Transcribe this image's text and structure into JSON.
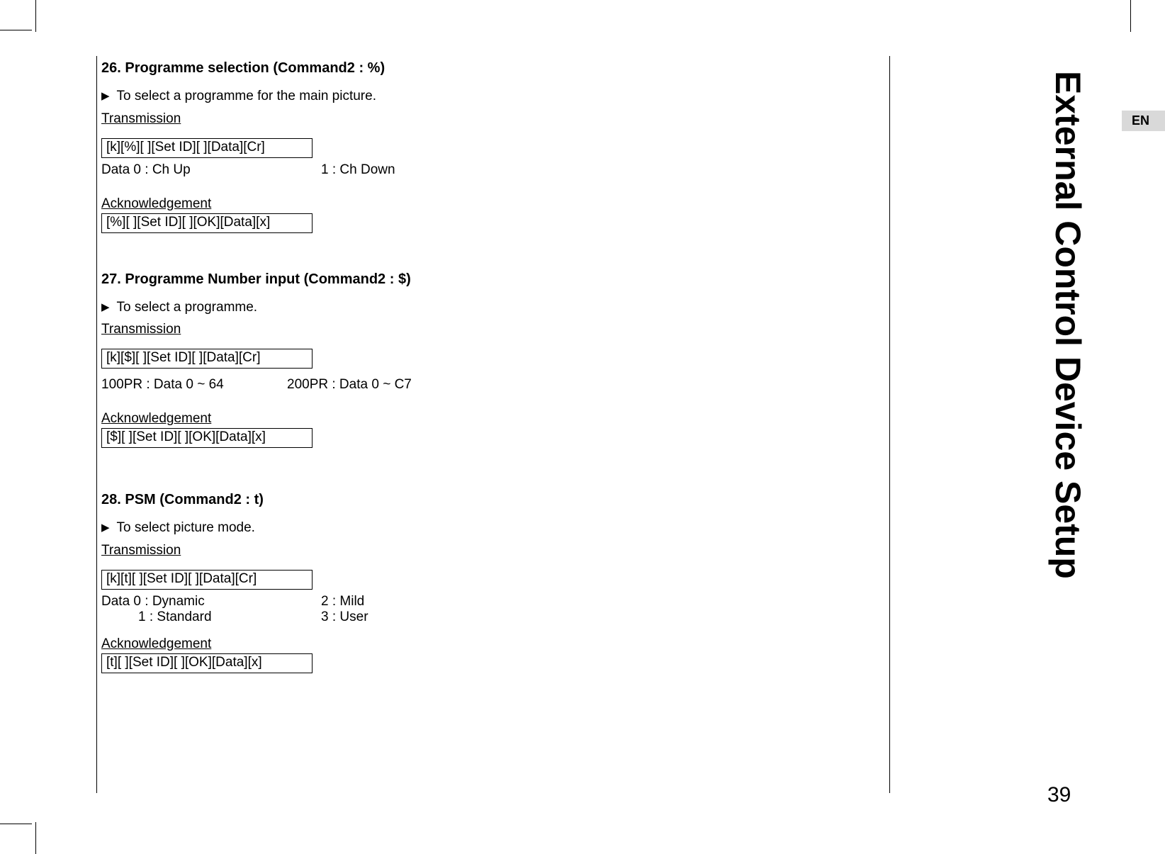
{
  "side_title": "External Control Device Setup",
  "lang_tab": "EN",
  "page_number": "39",
  "sections": [
    {
      "title": "26. Programme selection (Command2 : %)",
      "desc": "To select a programme for the main picture.",
      "trans_label": "Transmission",
      "trans_cmd": "[k][%][  ][Set ID][  ][Data][Cr]",
      "data_lines": [
        {
          "col1": "Data  0  : Ch Up",
          "col2": "1  : Ch Down"
        }
      ],
      "ack_label": "Acknowledgement",
      "ack_cmd": "[%][  ][Set ID][  ][OK][Data][x]"
    },
    {
      "title": "27. Programme Number input (Command2 : $)",
      "desc": "To select a programme.",
      "trans_label": "Transmission",
      "trans_cmd": "[k][$][  ][Set ID][  ][Data][Cr]",
      "data_lines": [
        {
          "col1": "100PR : Data 0 ~ 64",
          "col2": "200PR :  Data 0 ~ C7"
        }
      ],
      "ack_label": "Acknowledgement",
      "ack_cmd": "[$][  ][Set ID][  ][OK][Data][x]"
    },
    {
      "title": "28. PSM (Command2 : t)",
      "desc": "To select picture mode.",
      "trans_label": "Transmission",
      "trans_cmd": "[k][t][  ][Set ID][  ][Data][Cr]",
      "data_lines": [
        {
          "col1": "Data  0  : Dynamic",
          "col2": "2  : Mild"
        },
        {
          "col1_sub": "1  : Standard",
          "col2": "3  : User"
        }
      ],
      "ack_label": "Acknowledgement",
      "ack_cmd": "[t][  ][Set ID][  ][OK][Data][x]"
    }
  ]
}
